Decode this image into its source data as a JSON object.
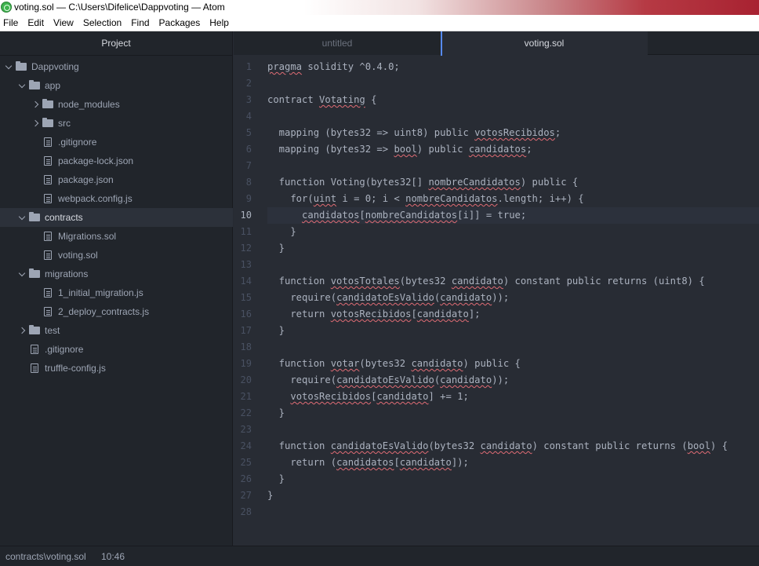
{
  "window": {
    "title": "voting.sol — C:\\Users\\Difelice\\Dappvoting — Atom"
  },
  "menu": [
    "File",
    "Edit",
    "View",
    "Selection",
    "Find",
    "Packages",
    "Help"
  ],
  "tree": {
    "header": "Project",
    "items": [
      {
        "label": "Dappvoting",
        "type": "folder",
        "depth": 0,
        "expanded": true
      },
      {
        "label": "app",
        "type": "folder",
        "depth": 1,
        "expanded": true
      },
      {
        "label": "node_modules",
        "type": "folder",
        "depth": 2,
        "expanded": false
      },
      {
        "label": "src",
        "type": "folder",
        "depth": 2,
        "expanded": false
      },
      {
        "label": ".gitignore",
        "type": "file",
        "depth": 2
      },
      {
        "label": "package-lock.json",
        "type": "file",
        "depth": 2
      },
      {
        "label": "package.json",
        "type": "file",
        "depth": 2
      },
      {
        "label": "webpack.config.js",
        "type": "file",
        "depth": 2
      },
      {
        "label": "contracts",
        "type": "folder",
        "depth": 1,
        "expanded": true,
        "selected": true
      },
      {
        "label": "Migrations.sol",
        "type": "file",
        "depth": 2
      },
      {
        "label": "voting.sol",
        "type": "file",
        "depth": 2
      },
      {
        "label": "migrations",
        "type": "folder",
        "depth": 1,
        "expanded": true
      },
      {
        "label": "1_initial_migration.js",
        "type": "file",
        "depth": 2
      },
      {
        "label": "2_deploy_contracts.js",
        "type": "file",
        "depth": 2
      },
      {
        "label": "test",
        "type": "folder",
        "depth": 1,
        "expanded": false
      },
      {
        "label": ".gitignore",
        "type": "file",
        "depth": 1
      },
      {
        "label": "truffle-config.js",
        "type": "file",
        "depth": 1
      }
    ]
  },
  "tabs": [
    {
      "label": "untitled",
      "active": false
    },
    {
      "label": "voting.sol",
      "active": true
    }
  ],
  "editor": {
    "current_line": 10,
    "lines": [
      "{pragma} solidity ^0.4.0;",
      "",
      "contract {Votating} {",
      "",
      "  mapping (bytes32 => uint8) public {votosRecibidos};",
      "  mapping (bytes32 => {bool}) public {candidatos};",
      "",
      "  function Voting(bytes32[] {nombreCandidatos}) public {",
      "    for({uint} i = 0; i < {nombreCandidatos}.length; i++) {",
      "      {candidatos}[{nombreCandidatos}[i]] = true;",
      "    }",
      "  }",
      "",
      "  function {votosTotales}(bytes32 {candidato}) constant public returns (uint8) {",
      "    require({candidatoEsValido}({candidato}));",
      "    return {votosRecibidos}[{candidato}];",
      "  }",
      "",
      "  function {votar}(bytes32 {candidato}) public {",
      "    require({candidatoEsValido}({candidato}));",
      "    {votosRecibidos}[{candidato}] += 1;",
      "  }",
      "",
      "  function {candidatoEsValido}(bytes32 {candidato}) constant public returns ({bool}) {",
      "    return ({candidatos}[{candidato}]);",
      "  }",
      "}",
      ""
    ]
  },
  "status": {
    "path": "contracts\\voting.sol",
    "position": "10:46"
  },
  "colors": {
    "accent": "#568af2",
    "spell_error": "#e06c75"
  }
}
